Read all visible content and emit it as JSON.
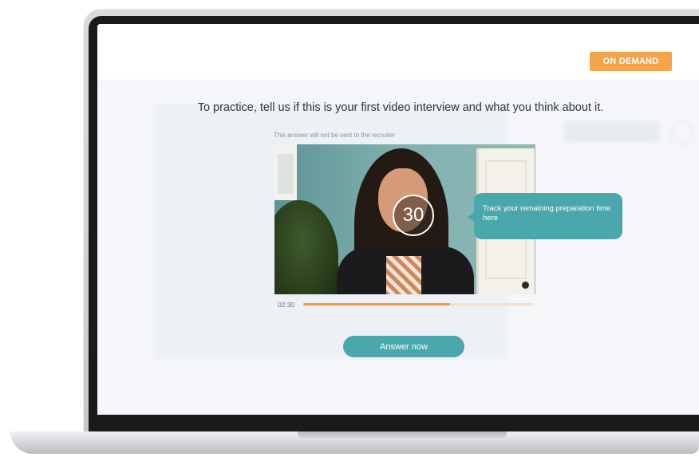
{
  "badge": {
    "label": "ON DEMAND"
  },
  "prompt": {
    "heading": "To practice, tell us if this is your first video interview and what you think about it.",
    "note": "This answer will not be sent to the recruiter"
  },
  "video": {
    "countdown": "30",
    "tooltip": "Track your remaining preparation time here",
    "elapsed": "02:30",
    "progress": 0.64
  },
  "actions": {
    "answer_label": "Answer now"
  },
  "colors": {
    "accent": "#4aa8ad",
    "badge": "#f5a44a",
    "progress": "#f59b3c"
  }
}
